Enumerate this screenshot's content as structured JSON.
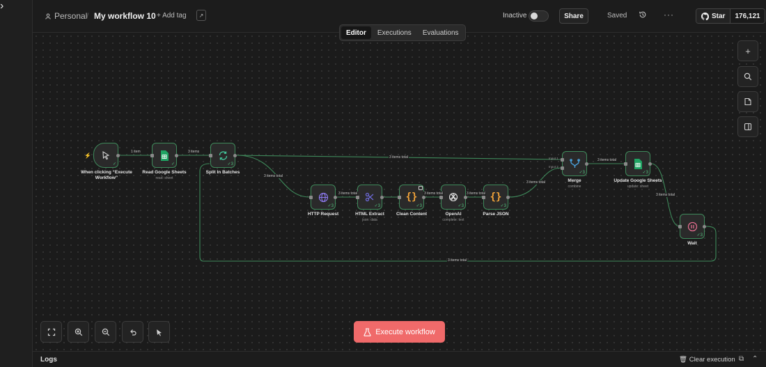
{
  "header": {
    "project": "Personal",
    "workflow_title": "My workflow 10",
    "add_tag": "+ Add tag",
    "active_label": "Inactive",
    "share": "Share",
    "saved": "Saved",
    "github_star": "Star",
    "github_count": "176,121"
  },
  "tabs": [
    {
      "label": "Editor",
      "active": true
    },
    {
      "label": "Executions",
      "active": false
    },
    {
      "label": "Evaluations",
      "active": false
    }
  ],
  "nodes": {
    "trigger": {
      "label": "When clicking “Execute Workflow”",
      "icon": "cursor-icon"
    },
    "read_sheets": {
      "label": "Read Google Sheets",
      "sub": "read: sheet",
      "icon": "google-sheets-icon"
    },
    "split": {
      "label": "Split In Batches",
      "icon": "refresh-icon"
    },
    "http": {
      "label": "HTTP Request",
      "icon": "globe-icon"
    },
    "html": {
      "label": "HTML Extract",
      "sub": "json: data",
      "icon": "scissors-icon"
    },
    "clean": {
      "label": "Clean Content",
      "icon": "code-braces-icon"
    },
    "openai": {
      "label": "OpenAI",
      "sub": "complete: text",
      "icon": "openai-icon"
    },
    "parse": {
      "label": "Parse JSON",
      "icon": "code-braces-icon"
    },
    "merge": {
      "label": "Merge",
      "sub": "combine",
      "icon": "merge-icon"
    },
    "update_sheets": {
      "label": "Update Google Sheets",
      "sub": "update: sheet",
      "icon": "google-sheets-icon"
    },
    "wait": {
      "label": "Wait",
      "icon": "pause-icon"
    }
  },
  "edges": {
    "trigger_read": "1 item",
    "read_split": "3 items",
    "split_merge": "3 items total",
    "split_http": "3 items total",
    "http_html": "3 items total",
    "clean_openai": "3 items total",
    "openai_parse": "3 items total",
    "parse_merge": "3 items total",
    "merge_update": "3 items total",
    "update_wait": "3 items total",
    "wait_loop": "3 items total",
    "merge_input1": "Input 1",
    "merge_input2": "Input 2"
  },
  "node_counts": {
    "default": "3"
  },
  "execute_button": "Execute workflow",
  "logs": {
    "title": "Logs",
    "clear": "Clear execution"
  },
  "colors": {
    "accent": "#f06a6a",
    "wire": "#3f8a5b",
    "success": "#4fc17c"
  }
}
